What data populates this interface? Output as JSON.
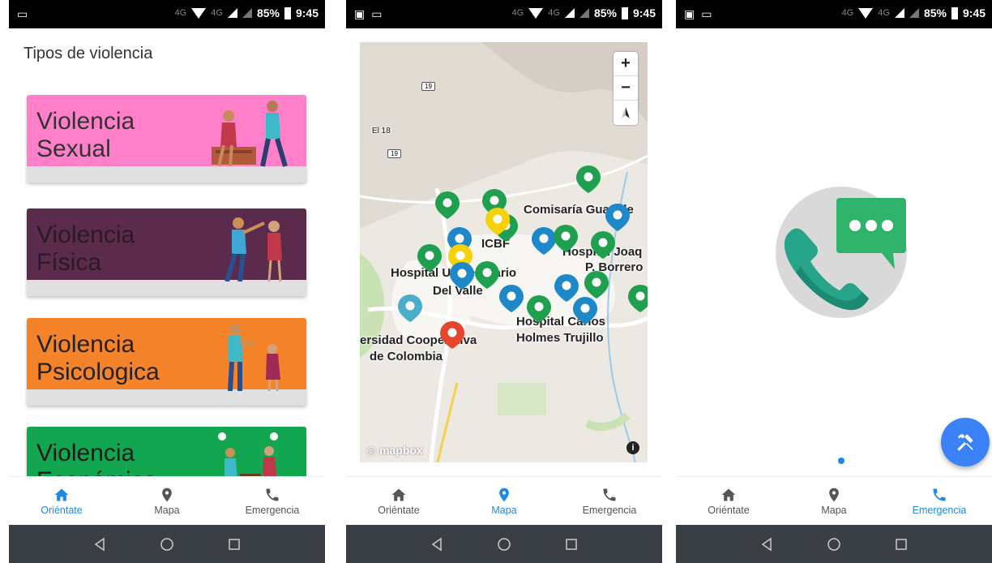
{
  "status_bar": {
    "network": "4G",
    "network_secondary": "4G",
    "battery": "85%",
    "time": "9:45"
  },
  "orientate": {
    "title": "Tipos de violencia",
    "cards": [
      {
        "label": "Violencia Sexual",
        "color": "#ff80c8",
        "text_color": "#333333"
      },
      {
        "label": "Violencia Física",
        "color": "#5b2b4c",
        "text_color": "#2a1a24"
      },
      {
        "label": "Violencia Psicologica",
        "color": "#f5832a",
        "text_color": "#222222"
      },
      {
        "label": "Violencia Económica",
        "color": "#13a650",
        "text_color": "#1a1a1a"
      }
    ]
  },
  "map": {
    "labels": {
      "comisaria": "Comisaría Guadale",
      "icbf": "ICBF",
      "hospital_joaquin": "Hospital Joaq",
      "borrero": "P. Borrero",
      "hospital_universitario": "Hospital Universitario",
      "del_valle": "Del Valle",
      "hospital_carlos": "Hospital Carlos",
      "holmes": "Holmes Trujillo",
      "universidad": "ersidad Cooperativa",
      "de_colombia": "de Colombia",
      "el18": "El 18"
    },
    "road_shields": [
      "19",
      "19"
    ],
    "zoom_in": "+",
    "zoom_out": "−",
    "attribution": "mapbox",
    "info": "i",
    "marker_colors": {
      "green": "#1fa04f",
      "blue": "#1e88c8",
      "yellow": "#f5d20a",
      "red": "#e4462b",
      "teal": "#4aaec9"
    }
  },
  "nav": {
    "items": [
      {
        "label": "Oriéntate",
        "icon": "home-icon"
      },
      {
        "label": "Mapa",
        "icon": "location-pin-icon"
      },
      {
        "label": "Emergencia",
        "icon": "phone-icon"
      }
    ],
    "active_color": "#1e88e5"
  },
  "emergency": {
    "fab_icon": "tools-icon",
    "illustration": "phone-chat-icon"
  }
}
